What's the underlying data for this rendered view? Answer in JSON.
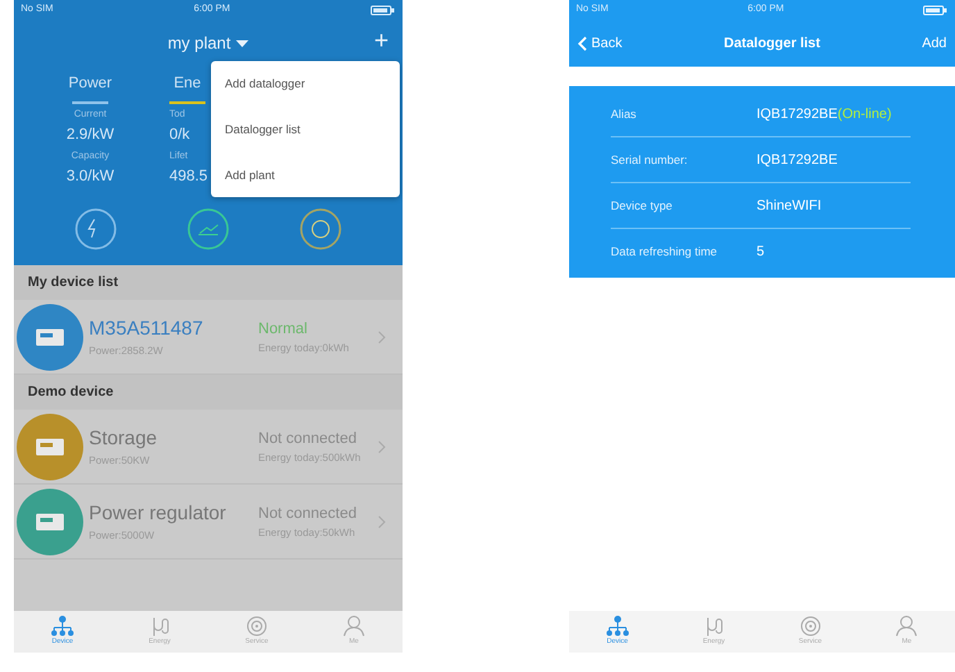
{
  "left_screen": {
    "status_bar": {
      "carrier": "No SIM",
      "time": "6:00 PM"
    },
    "title": "my plant",
    "add_symbol": "+",
    "tabs": [
      {
        "label": "Power",
        "selected": false
      },
      {
        "label": "Ene",
        "selected": true
      }
    ],
    "stats": [
      {
        "label": "Current",
        "value": "2.9/kW"
      },
      {
        "label": "Tod",
        "value": "0/k"
      },
      {
        "label": "Capacity",
        "value": "3.0/kW"
      },
      {
        "label": "Lifet",
        "value": "498.5"
      }
    ],
    "menu": {
      "items": [
        "Add datalogger",
        "Datalogger list",
        "Add plant"
      ]
    },
    "sections": [
      {
        "title": "My device list",
        "devices": [
          {
            "name": "M35A511487",
            "status": "Normal",
            "online": true,
            "power": "Power:2858.2W",
            "energy": "Energy today:0kWh",
            "color": "#2f86c4"
          }
        ]
      },
      {
        "title": "Demo device",
        "devices": [
          {
            "name": "Storage",
            "status": "Not connected",
            "online": false,
            "power": "Power:50KW",
            "energy": "Energy today:500kWh",
            "color": "#b8902a"
          },
          {
            "name": "Power regulator",
            "status": "Not connected",
            "online": false,
            "power": "Power:5000W",
            "energy": "Energy today:50kWh",
            "color": "#3aa08e"
          }
        ]
      }
    ],
    "tab_bar": [
      {
        "label": "Device",
        "selected": true
      },
      {
        "label": "Energy",
        "selected": false
      },
      {
        "label": "Service",
        "selected": false
      },
      {
        "label": "Me",
        "selected": false
      }
    ]
  },
  "right_screen": {
    "status_bar": {
      "carrier": "No SIM",
      "time": "6:00 PM"
    },
    "back": "Back",
    "title": "Datalogger list",
    "add": "Add",
    "fields": [
      {
        "label": "Alias",
        "value": "IQB17292BE",
        "status": "(On-line)"
      },
      {
        "label": "Serial number:",
        "value": "IQB17292BE"
      },
      {
        "label": "Device type",
        "value": "ShineWIFI"
      },
      {
        "label": "Data refreshing time",
        "value": "5"
      }
    ],
    "tab_bar": [
      {
        "label": "Device",
        "selected": true
      },
      {
        "label": "Energy",
        "selected": false
      },
      {
        "label": "Service",
        "selected": false
      },
      {
        "label": "Me",
        "selected": false
      }
    ]
  }
}
